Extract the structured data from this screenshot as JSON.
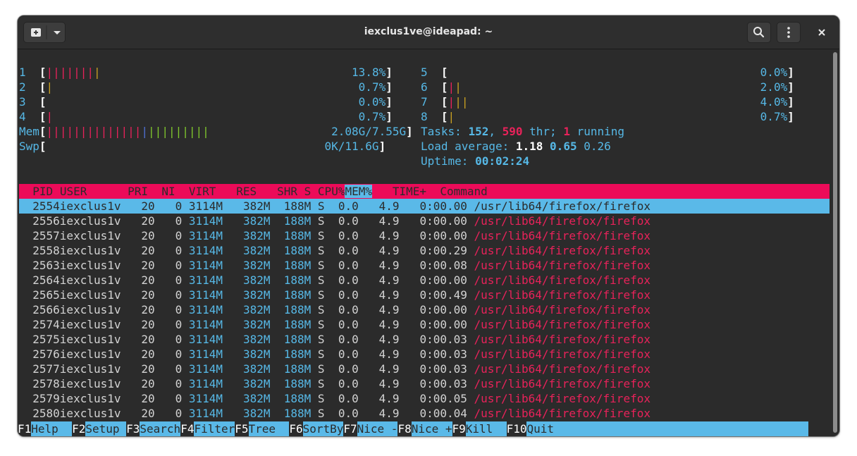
{
  "window": {
    "title": "iexclus1ve@ideapad: ~"
  },
  "cpus": [
    {
      "num": "1",
      "pct": "13.8%"
    },
    {
      "num": "2",
      "pct": "0.7%"
    },
    {
      "num": "3",
      "pct": "0.0%"
    },
    {
      "num": "4",
      "pct": "0.7%"
    },
    {
      "num": "5",
      "pct": "0.0%"
    },
    {
      "num": "6",
      "pct": "2.0%"
    },
    {
      "num": "7",
      "pct": "4.0%"
    },
    {
      "num": "8",
      "pct": "0.7%"
    }
  ],
  "mem": {
    "label": "Mem",
    "value": "2.08G/7.55G"
  },
  "swp": {
    "label": "Swp",
    "value": "0K/11.6G"
  },
  "tasks": {
    "label": "Tasks:",
    "count": "152",
    "thr": "590",
    "thr_label": "thr;",
    "running": "1",
    "running_label": "running"
  },
  "load": {
    "label": "Load average:",
    "v1": "1.18",
    "v5": "0.65",
    "v15": "0.26"
  },
  "uptime": {
    "label": "Uptime:",
    "value": "00:02:24"
  },
  "columns": [
    "PID",
    "USER",
    "PRI",
    "NI",
    "VIRT",
    "RES",
    "SHR",
    "S",
    "CPU%",
    "MEM%",
    "TIME+",
    "Command"
  ],
  "processes": [
    {
      "pid": "2554",
      "user": "iexclus1v",
      "pri": "20",
      "ni": "0",
      "virt": "3114M",
      "res": "382M",
      "shr": "188M",
      "s": "S",
      "cpu": "0.0",
      "mem": "4.9",
      "time": "0:00.00",
      "cmd": "/usr/lib64/firefox/firefox"
    },
    {
      "pid": "2556",
      "user": "iexclus1v",
      "pri": "20",
      "ni": "0",
      "virt": "3114M",
      "res": "382M",
      "shr": "188M",
      "s": "S",
      "cpu": "0.0",
      "mem": "4.9",
      "time": "0:00.00",
      "cmd": "/usr/lib64/firefox/firefox"
    },
    {
      "pid": "2557",
      "user": "iexclus1v",
      "pri": "20",
      "ni": "0",
      "virt": "3114M",
      "res": "382M",
      "shr": "188M",
      "s": "S",
      "cpu": "0.0",
      "mem": "4.9",
      "time": "0:00.00",
      "cmd": "/usr/lib64/firefox/firefox"
    },
    {
      "pid": "2558",
      "user": "iexclus1v",
      "pri": "20",
      "ni": "0",
      "virt": "3114M",
      "res": "382M",
      "shr": "188M",
      "s": "S",
      "cpu": "0.0",
      "mem": "4.9",
      "time": "0:00.29",
      "cmd": "/usr/lib64/firefox/firefox"
    },
    {
      "pid": "2563",
      "user": "iexclus1v",
      "pri": "20",
      "ni": "0",
      "virt": "3114M",
      "res": "382M",
      "shr": "188M",
      "s": "S",
      "cpu": "0.0",
      "mem": "4.9",
      "time": "0:00.08",
      "cmd": "/usr/lib64/firefox/firefox"
    },
    {
      "pid": "2564",
      "user": "iexclus1v",
      "pri": "20",
      "ni": "0",
      "virt": "3114M",
      "res": "382M",
      "shr": "188M",
      "s": "S",
      "cpu": "0.0",
      "mem": "4.9",
      "time": "0:00.00",
      "cmd": "/usr/lib64/firefox/firefox"
    },
    {
      "pid": "2565",
      "user": "iexclus1v",
      "pri": "20",
      "ni": "0",
      "virt": "3114M",
      "res": "382M",
      "shr": "188M",
      "s": "S",
      "cpu": "0.0",
      "mem": "4.9",
      "time": "0:00.49",
      "cmd": "/usr/lib64/firefox/firefox"
    },
    {
      "pid": "2566",
      "user": "iexclus1v",
      "pri": "20",
      "ni": "0",
      "virt": "3114M",
      "res": "382M",
      "shr": "188M",
      "s": "S",
      "cpu": "0.0",
      "mem": "4.9",
      "time": "0:00.00",
      "cmd": "/usr/lib64/firefox/firefox"
    },
    {
      "pid": "2574",
      "user": "iexclus1v",
      "pri": "20",
      "ni": "0",
      "virt": "3114M",
      "res": "382M",
      "shr": "188M",
      "s": "S",
      "cpu": "0.0",
      "mem": "4.9",
      "time": "0:00.00",
      "cmd": "/usr/lib64/firefox/firefox"
    },
    {
      "pid": "2575",
      "user": "iexclus1v",
      "pri": "20",
      "ni": "0",
      "virt": "3114M",
      "res": "382M",
      "shr": "188M",
      "s": "S",
      "cpu": "0.0",
      "mem": "4.9",
      "time": "0:00.03",
      "cmd": "/usr/lib64/firefox/firefox"
    },
    {
      "pid": "2576",
      "user": "iexclus1v",
      "pri": "20",
      "ni": "0",
      "virt": "3114M",
      "res": "382M",
      "shr": "188M",
      "s": "S",
      "cpu": "0.0",
      "mem": "4.9",
      "time": "0:00.03",
      "cmd": "/usr/lib64/firefox/firefox"
    },
    {
      "pid": "2577",
      "user": "iexclus1v",
      "pri": "20",
      "ni": "0",
      "virt": "3114M",
      "res": "382M",
      "shr": "188M",
      "s": "S",
      "cpu": "0.0",
      "mem": "4.9",
      "time": "0:00.03",
      "cmd": "/usr/lib64/firefox/firefox"
    },
    {
      "pid": "2578",
      "user": "iexclus1v",
      "pri": "20",
      "ni": "0",
      "virt": "3114M",
      "res": "382M",
      "shr": "188M",
      "s": "S",
      "cpu": "0.0",
      "mem": "4.9",
      "time": "0:00.03",
      "cmd": "/usr/lib64/firefox/firefox"
    },
    {
      "pid": "2579",
      "user": "iexclus1v",
      "pri": "20",
      "ni": "0",
      "virt": "3114M",
      "res": "382M",
      "shr": "188M",
      "s": "S",
      "cpu": "0.0",
      "mem": "4.9",
      "time": "0:00.05",
      "cmd": "/usr/lib64/firefox/firefox"
    },
    {
      "pid": "2580",
      "user": "iexclus1v",
      "pri": "20",
      "ni": "0",
      "virt": "3114M",
      "res": "382M",
      "shr": "188M",
      "s": "S",
      "cpu": "0.0",
      "mem": "4.9",
      "time": "0:00.04",
      "cmd": "/usr/lib64/firefox/firefox"
    }
  ],
  "fkeys": [
    {
      "key": "F1",
      "label": "Help  "
    },
    {
      "key": "F2",
      "label": "Setup "
    },
    {
      "key": "F3",
      "label": "Search"
    },
    {
      "key": "F4",
      "label": "Filter"
    },
    {
      "key": "F5",
      "label": "Tree  "
    },
    {
      "key": "F6",
      "label": "SortBy"
    },
    {
      "key": "F7",
      "label": "Nice -"
    },
    {
      "key": "F8",
      "label": "Nice +"
    },
    {
      "key": "F9",
      "label": "Kill  "
    },
    {
      "key": "F10",
      "label": "Quit  "
    }
  ],
  "icons": {
    "new_tab": "new-tab-icon",
    "menu_arrow": "chevron-down-icon",
    "search": "search-icon",
    "kebab": "kebab-menu-icon",
    "close": "close-icon"
  },
  "colors": {
    "header_bg": "#ec0b59",
    "selected_bg": "#5ab9e8",
    "cyan": "#56b8e6",
    "red": "#e8225a",
    "terminal_bg": "#2b2b2b"
  }
}
